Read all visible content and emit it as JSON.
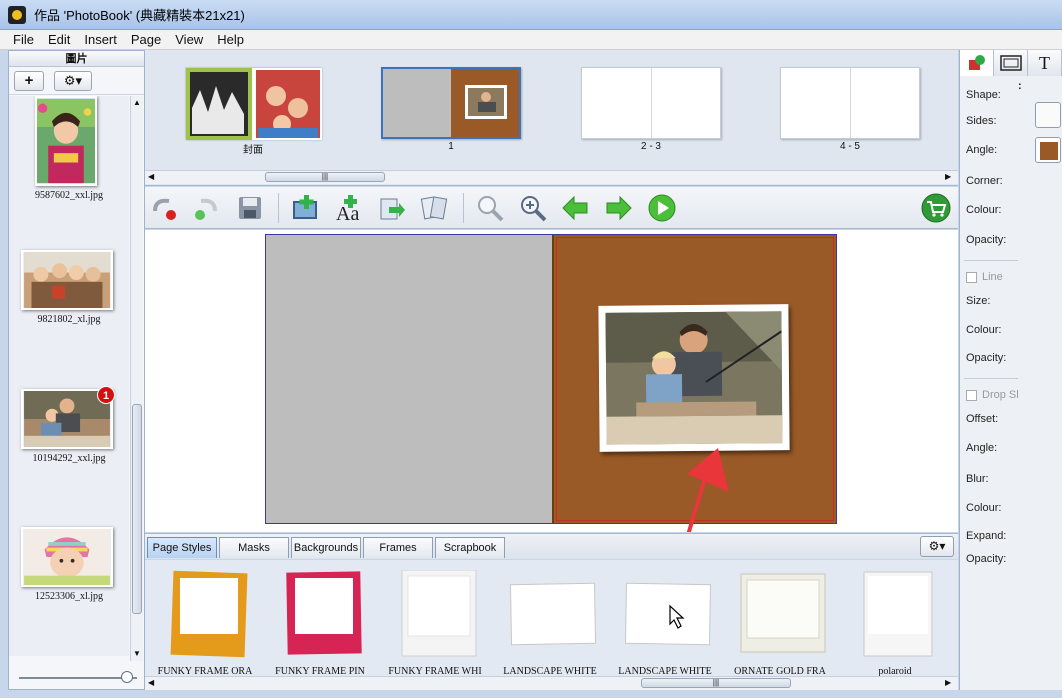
{
  "window": {
    "title": "作品 'PhotoBook' (典藏精裝本21x21)"
  },
  "menu": [
    "File",
    "Edit",
    "Insert",
    "Page",
    "View",
    "Help"
  ],
  "left_panel": {
    "header": "圖片",
    "add_label": "+",
    "gear_label": "⚙▾",
    "photos": [
      {
        "caption": "9587602_xxl.jpg",
        "badge": ""
      },
      {
        "caption": "9821802_xl.jpg",
        "badge": ""
      },
      {
        "caption": "10194292_xxl.jpg",
        "badge": "1"
      },
      {
        "caption": "12523306_xl.jpg",
        "badge": ""
      }
    ]
  },
  "page_strip": {
    "pages": [
      {
        "label": "封面"
      },
      {
        "label": "1"
      },
      {
        "label": "2 - 3"
      },
      {
        "label": "4 - 5"
      }
    ],
    "scroll_grip": "|||"
  },
  "toolbar": {
    "tools": [
      "undo-icon",
      "redo-icon",
      "save-icon",
      "add-photo-icon",
      "add-text-icon",
      "import-icon",
      "export-icon",
      "zoom-out-icon",
      "zoom-in-icon",
      "previous-page-icon",
      "next-page-icon",
      "play-icon",
      "cart-icon"
    ]
  },
  "tabs": [
    "Page Styles",
    "Masks",
    "Backgrounds",
    "Frames",
    "Scrapbook"
  ],
  "tabs_gear": "⚙▾",
  "styles": [
    {
      "caption": "FUNKY FRAME ORA",
      "color": "#e49a1a"
    },
    {
      "caption": "FUNKY FRAME PIN",
      "color": "#d62455"
    },
    {
      "caption": "FUNKY FRAME WHI",
      "color": "#f4f4f4"
    },
    {
      "caption": "LANDSCAPE WHITE",
      "color": "#ffffff"
    },
    {
      "caption": "LANDSCAPE WHITE",
      "color": "#ffffff"
    },
    {
      "caption": "ORNATE GOLD FRA",
      "color": "#efeee4"
    },
    {
      "caption": "polaroid",
      "color": "#f6f6f6"
    }
  ],
  "gallery_grip": "|||",
  "properties": {
    "shape": "Shape:",
    "shape_value": ":",
    "sides": "Sides:",
    "angle": "Angle:",
    "corner": "Corner:",
    "colour": "Colour:",
    "opacity": "Opacity:",
    "line": "Line",
    "size": "Size:",
    "line_colour": "Colour:",
    "line_opacity": "Opacity:",
    "drop_shadow": "Drop Sl",
    "offset": "Offset:",
    "shadow_angle": "Angle:",
    "blur": "Blur:",
    "shadow_colour": "Colour:",
    "expand": "Expand:",
    "shadow_opacity": "Opacity:",
    "fill_swatch": "#9a5a27",
    "text_tab_label": "T"
  },
  "colors": {
    "background_brown": "#9a5a27",
    "left_page_gray": "#bdbdbd",
    "arrow_red": "#e8363a"
  }
}
